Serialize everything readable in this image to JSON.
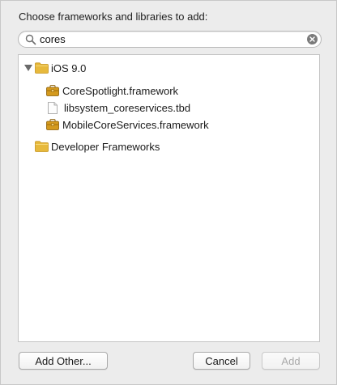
{
  "dialog": {
    "prompt": "Choose frameworks and libraries to add:"
  },
  "search": {
    "value": "cores",
    "placeholder": ""
  },
  "tree": {
    "group_ios": {
      "label": "iOS 9.0",
      "expanded": true,
      "items": [
        {
          "label": "CoreSpotlight.framework",
          "icon": "framework-icon"
        },
        {
          "label": "libsystem_coreservices.tbd",
          "icon": "document-icon"
        },
        {
          "label": "MobileCoreServices.framework",
          "icon": "framework-icon"
        }
      ]
    },
    "group_dev": {
      "label": "Developer Frameworks",
      "expanded": false
    }
  },
  "buttons": {
    "add_other": "Add Other...",
    "cancel": "Cancel",
    "add": "Add"
  },
  "colors": {
    "folder": "#e7b93c",
    "framework": "#c98b12",
    "disabled_text": "#a9a9a9"
  }
}
